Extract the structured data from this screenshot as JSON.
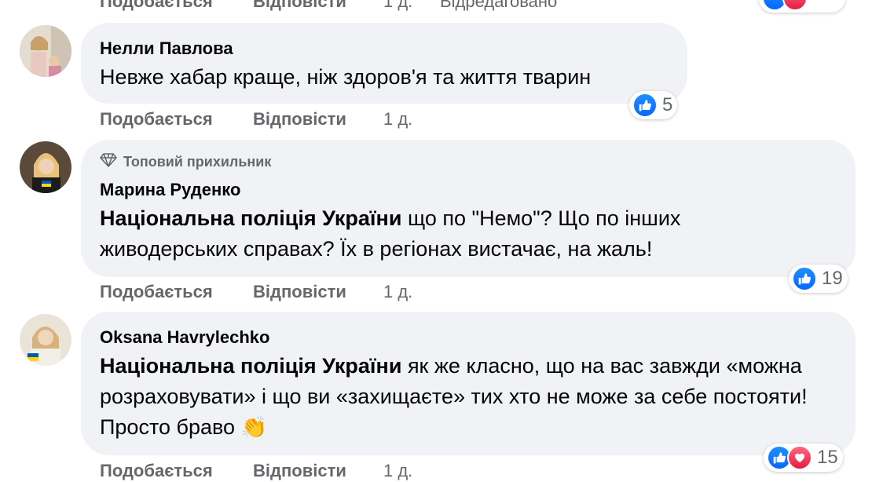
{
  "top_row": {
    "like_label": "Подобається",
    "reply_label": "Відповісти",
    "time": "1 д.",
    "edited": "Відредаговано"
  },
  "comments": [
    {
      "author": "Нелли Павлова",
      "text": "Невже хабар краще, ніж здоров'я та життя тварин",
      "reactions": "5",
      "like_label": "Подобається",
      "reply_label": "Відповісти",
      "time": "1 д."
    },
    {
      "badge": "Топовий прихильник",
      "author": "Марина Руденко",
      "mention": "Національна поліція України",
      "text": " що по \"Немо\"? Що по інших живодерських справах? Їх в регіонах вистачає, на жаль!",
      "reactions": "19",
      "like_label": "Подобається",
      "reply_label": "Відповісти",
      "time": "1 д."
    },
    {
      "author": "Oksana Havrylechko",
      "mention": "Національна поліція України",
      "text": " як же класно, що на вас завжди «можна розраховувати» і що ви «захищаєте» тих хто не може за себе постояти! Просто браво",
      "emoji": "👏",
      "reactions": "15",
      "like_label": "Подобається",
      "reply_label": "Відповісти",
      "time": "1 д."
    }
  ],
  "icons": {
    "like": "like-icon",
    "love": "love-icon",
    "badge": "diamond-icon"
  },
  "colors": {
    "bubble": "#f0f2f5",
    "secondary_text": "#65676b",
    "like_blue": "#0866ff",
    "love_red": "#e41e3f"
  }
}
